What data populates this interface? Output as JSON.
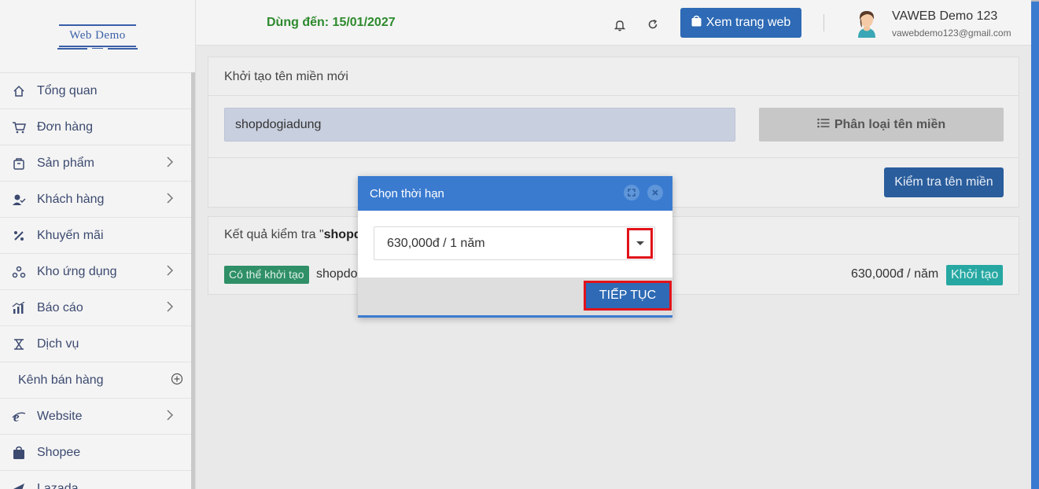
{
  "logo": {
    "text": "Web Demo"
  },
  "topbar": {
    "expiry": "Dùng đến: 15/01/2027",
    "view_site": "Xem trang web",
    "user_name": "VAWEB Demo 123",
    "user_email": "vawebdemo123@gmail.com"
  },
  "sidebar": {
    "items": [
      {
        "label": "Tổng quan",
        "icon": "home-icon"
      },
      {
        "label": "Đơn hàng",
        "icon": "cart-icon"
      },
      {
        "label": "Sản phẩm",
        "icon": "box-icon"
      },
      {
        "label": "Khách hàng",
        "icon": "user-check-icon"
      },
      {
        "label": "Khuyến mãi",
        "icon": "percent-icon"
      },
      {
        "label": "Kho ứng dụng",
        "icon": "apps-icon"
      },
      {
        "label": "Báo cáo",
        "icon": "chart-icon"
      },
      {
        "label": "Dịch vụ",
        "icon": "service-icon"
      },
      {
        "label": "Kênh bán hàng",
        "icon": "plus-circle-icon"
      },
      {
        "label": "Website",
        "icon": "ie-icon"
      },
      {
        "label": "Shopee",
        "icon": "bag-icon"
      },
      {
        "label": "Lazada",
        "icon": "send-icon"
      }
    ]
  },
  "create_panel": {
    "title": "Khởi tạo tên miền mới",
    "domain_value": "shopdogiadung",
    "classify_button": "Phân loại tên miền",
    "check_button": "Kiểm tra tên miền"
  },
  "result_panel": {
    "title_prefix": "Kết quả kiểm tra \"",
    "title_bold": "shopd",
    "status_badge": "Có thể khởi tạo",
    "domain": "shopdo",
    "price": "630,000đ / năm",
    "create_button": "Khởi tạo"
  },
  "modal": {
    "title": "Chọn thời hạn",
    "selected_option": "630,000đ / 1 năm",
    "continue_button": "TIẾP TỤC"
  },
  "colors": {
    "primary": "#2e6ab5",
    "modal_header": "#3a7bd0",
    "highlight": "#e2131a",
    "success": "#2f8f66",
    "teal": "#26a7a2",
    "expiry_green": "#2d8a2d"
  }
}
